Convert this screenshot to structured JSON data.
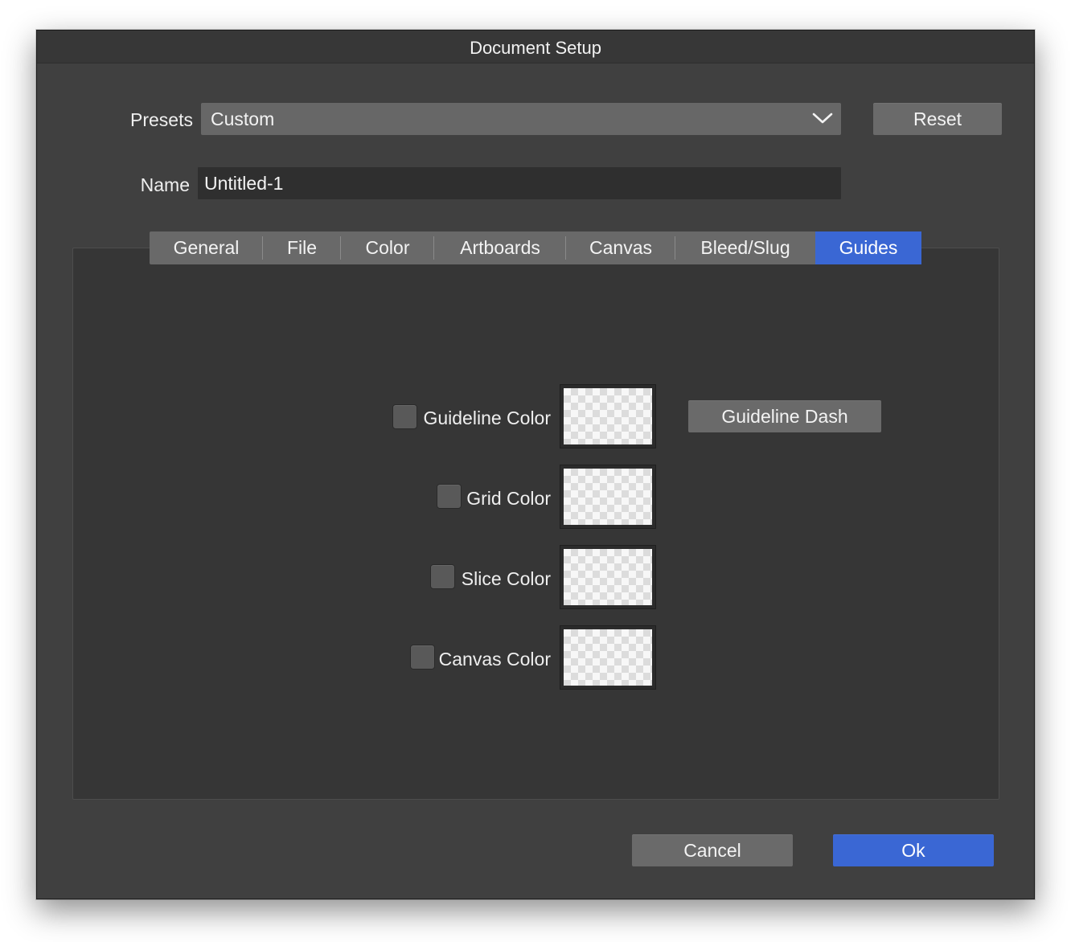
{
  "window": {
    "title": "Document Setup"
  },
  "presets": {
    "label": "Presets",
    "value": "Custom",
    "reset_label": "Reset"
  },
  "name": {
    "label": "Name",
    "value": "Untitled-1"
  },
  "tabs": [
    {
      "label": "General"
    },
    {
      "label": "File"
    },
    {
      "label": "Color"
    },
    {
      "label": "Artboards"
    },
    {
      "label": "Canvas"
    },
    {
      "label": "Bleed/Slug"
    },
    {
      "label": "Guides",
      "active": true
    }
  ],
  "guides": {
    "guideline": {
      "label": "Guideline Color",
      "checked": false
    },
    "grid": {
      "label": "Grid Color",
      "checked": false
    },
    "slice": {
      "label": "Slice Color",
      "checked": false
    },
    "canvas": {
      "label": "Canvas Color",
      "checked": false
    },
    "dash_button": "Guideline Dash"
  },
  "footer": {
    "cancel_label": "Cancel",
    "ok_label": "Ok"
  },
  "colors": {
    "accent": "#3a67d4",
    "window_bg": "#404040",
    "panel_bg": "#363636",
    "control_bg": "#6a6a6a"
  },
  "icons": {
    "dropdown": "chevron-down-icon"
  }
}
